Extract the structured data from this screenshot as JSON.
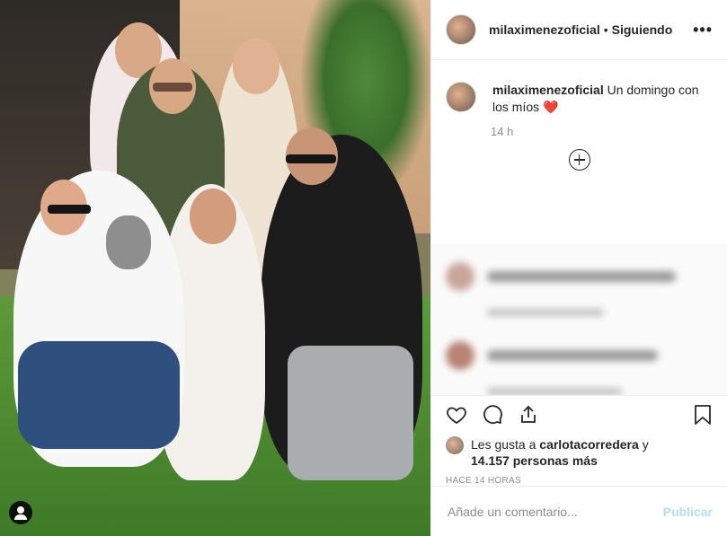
{
  "post": {
    "username": "milaximenezoficial",
    "follow_separator": "•",
    "follow_status": "Siguiendo",
    "more_icon": "more-horizontal-icon",
    "caption_text": "Un domingo con los míos",
    "caption_emoji": "❤️",
    "caption_time": "14 h",
    "likes_prefix": "Les gusta a",
    "likes_user": "carlotacorredera",
    "likes_connector": "y",
    "likes_count_text": "14.157 personas más",
    "timestamp": "HACE 14 HORAS",
    "comment_placeholder": "Añade un comentario...",
    "publish_label": "Publicar"
  },
  "icons": {
    "like": "heart-outline-icon",
    "comment": "comment-bubble-icon",
    "share": "share-icon",
    "save": "bookmark-icon",
    "load_more": "plus-circle-icon",
    "tag": "user-tag-icon"
  },
  "colors": {
    "publish_disabled": "#b2dffc",
    "secondary_text": "#8e8e8e",
    "primary_text": "#262626",
    "heart": "#e0242b"
  }
}
